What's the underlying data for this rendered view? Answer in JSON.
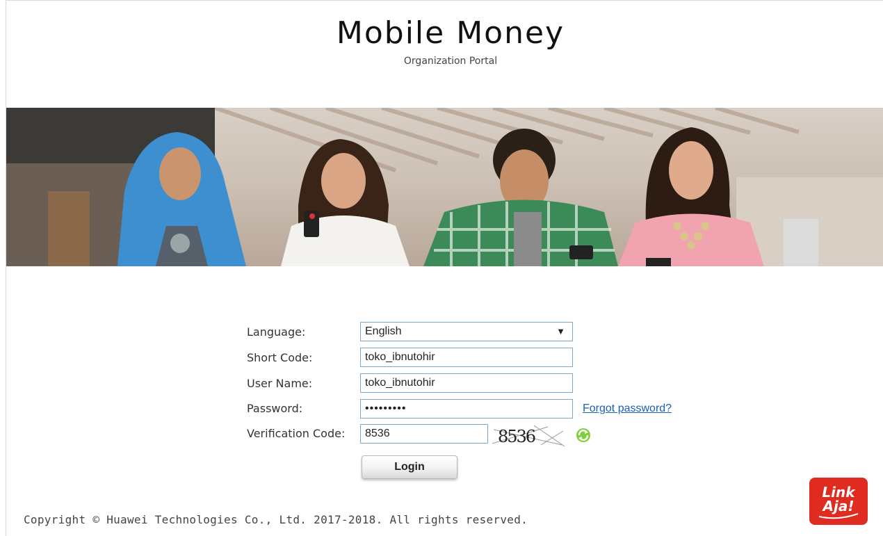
{
  "header": {
    "title": "Mobile Money",
    "subtitle": "Organization Portal"
  },
  "form": {
    "language": {
      "label": "Language:",
      "value": "English"
    },
    "short_code": {
      "label": "Short Code:",
      "value": "toko_ibnutohir"
    },
    "user_name": {
      "label": "User Name:",
      "value": "toko_ibnutohir"
    },
    "password": {
      "label": "Password:",
      "value": "•••••••••"
    },
    "forgot_password": "Forgot password?",
    "verification": {
      "label": "Verification Code:",
      "value": "8536",
      "captcha_text": "8536"
    },
    "login_label": "Login"
  },
  "footer": {
    "copyright": "Copyright © Huawei Technologies Co., Ltd. 2017-2018. All rights reserved."
  },
  "logo": {
    "line1": "Link",
    "line2": "Aja!"
  },
  "colors": {
    "link": "#1a5fb4",
    "logo_red": "#e02b20",
    "field_border": "#7fa7c9"
  }
}
